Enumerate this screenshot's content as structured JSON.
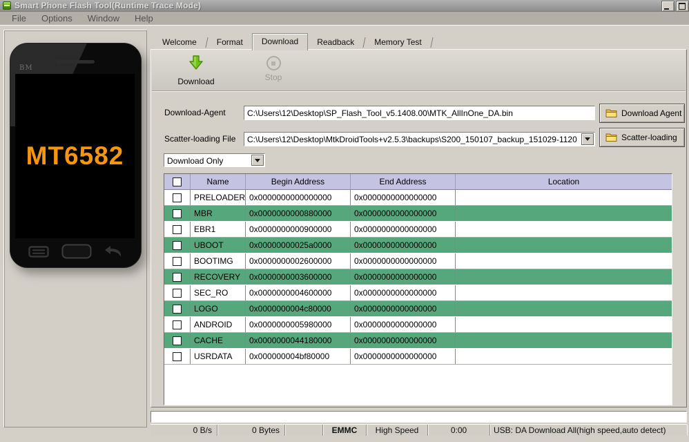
{
  "window": {
    "title": "Smart Phone Flash Tool(Runtime Trace Mode)"
  },
  "menu": {
    "items": [
      "File",
      "Options",
      "Window",
      "Help"
    ]
  },
  "phone": {
    "brand": "BM",
    "chipset": "MT6582"
  },
  "tabs": [
    "Welcome",
    "Format",
    "Download",
    "Readback",
    "Memory Test"
  ],
  "toolbar": {
    "download_label": "Download",
    "stop_label": "Stop"
  },
  "form": {
    "download_agent_label": "Download-Agent",
    "download_agent_value": "C:\\Users\\12\\Desktop\\SP_Flash_Tool_v5.1408.00\\MTK_AllInOne_DA.bin",
    "scatter_label": "Scatter-loading File",
    "scatter_value": "C:\\Users\\12\\Desktop\\MtkDroidTools+v2.5.3\\backups\\S200_150107_backup_151029-1120",
    "download_agent_button": "Download Agent",
    "scatter_button": "Scatter-loading",
    "mode_value": "Download Only"
  },
  "table": {
    "headers": {
      "name": "Name",
      "begin": "Begin Address",
      "end": "End Address",
      "location": "Location"
    },
    "rows": [
      {
        "name": "PRELOADER",
        "begin": "0x0000000000000000",
        "end": "0x0000000000000000",
        "location": ""
      },
      {
        "name": "MBR",
        "begin": "0x0000000000880000",
        "end": "0x0000000000000000",
        "location": ""
      },
      {
        "name": "EBR1",
        "begin": "0x0000000000900000",
        "end": "0x0000000000000000",
        "location": ""
      },
      {
        "name": "UBOOT",
        "begin": "0x00000000025a0000",
        "end": "0x0000000000000000",
        "location": ""
      },
      {
        "name": "BOOTIMG",
        "begin": "0x0000000002600000",
        "end": "0x0000000000000000",
        "location": ""
      },
      {
        "name": "RECOVERY",
        "begin": "0x0000000003600000",
        "end": "0x0000000000000000",
        "location": ""
      },
      {
        "name": "SEC_RO",
        "begin": "0x0000000004600000",
        "end": "0x0000000000000000",
        "location": ""
      },
      {
        "name": "LOGO",
        "begin": "0x0000000004c80000",
        "end": "0x0000000000000000",
        "location": ""
      },
      {
        "name": "ANDROID",
        "begin": "0x0000000005980000",
        "end": "0x0000000000000000",
        "location": ""
      },
      {
        "name": "CACHE",
        "begin": "0x0000000044180000",
        "end": "0x0000000000000000",
        "location": ""
      },
      {
        "name": "USRDATA",
        "begin": "0x000000004bf80000",
        "end": "0x0000000000000000",
        "location": ""
      }
    ]
  },
  "statusbar": {
    "speed": "0 B/s",
    "bytes": "0 Bytes",
    "storage": "EMMC",
    "link": "High Speed",
    "time": "0:00",
    "usb_info": "USB: DA Download All(high speed,auto detect)"
  },
  "colors": {
    "row_highlight_green": "#57a77d",
    "header_lavender": "#c5c3e2",
    "chipset_orange": "#f6950e",
    "window_gray": "#d4d0c8"
  }
}
